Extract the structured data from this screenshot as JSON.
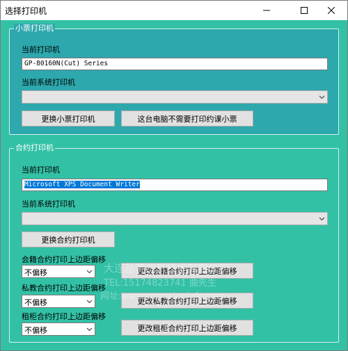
{
  "window": {
    "title": "选择打印机",
    "controls": [
      "minimize-icon",
      "maximize-icon",
      "close-icon"
    ]
  },
  "receipt_group": {
    "title": "小票打印机",
    "current_printer_label": "当前打印机",
    "current_printer_value": "GP-80160N(Cut) Series",
    "system_printer_label": "当前系统打印机",
    "system_printer_value": "",
    "change_button": "更换小票打印机",
    "no_print_button": "这台电脑不需要打印约课小票"
  },
  "contract_group": {
    "title": "合约打印机",
    "current_printer_label": "当前打印机",
    "current_printer_value": "Microsoft XPS Document Writer",
    "system_printer_label": "当前系统打印机",
    "system_printer_value": "",
    "change_button": "更换合约打印机",
    "offsets": [
      {
        "label": "会籍合约打印上边距偏移",
        "value": "不偏移",
        "button": "更改会籍合约打印上边距偏移"
      },
      {
        "label": "私教合约打印上边距偏移",
        "value": "不偏移",
        "button": "更改私教合约打印上边距偏移"
      },
      {
        "label": "租柜合约打印上边距偏移",
        "value": "不偏移",
        "button": "更改租柜合约打印上边距偏移"
      }
    ]
  },
  "watermark": {
    "line1": "大连丛笑信息技术有限公司",
    "line2": "TEL:15174823741 曲先生",
    "line3": "网址:www.congxiaoinfo.com"
  },
  "colors": {
    "receipt_group_bg": "#2da8ad",
    "client_bg": "#33c1a6",
    "selection": "#0078d7"
  }
}
